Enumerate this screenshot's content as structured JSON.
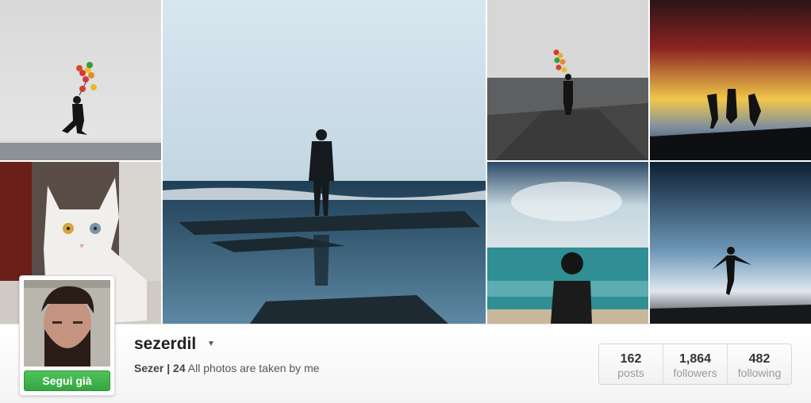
{
  "profile": {
    "username": "sezerdil",
    "bio_name": "Sezer | 24",
    "bio_text": "All photos are taken by me ",
    "bio_glyph": "",
    "follow_label": "Segui già"
  },
  "stats": [
    {
      "value": "162",
      "label": "posts"
    },
    {
      "value": "1,864",
      "label": "followers"
    },
    {
      "value": "482",
      "label": "following"
    }
  ],
  "colors": {
    "follow_button": "#3cb548"
  },
  "photos": [
    {
      "subject": "balloon-jump"
    },
    {
      "subject": "white-cat"
    },
    {
      "subject": "man-on-shore"
    },
    {
      "subject": "balloons-on-pier"
    },
    {
      "subject": "jumping-friends-sunset"
    },
    {
      "subject": "woman-on-beach"
    },
    {
      "subject": "jump-silhouette"
    }
  ]
}
